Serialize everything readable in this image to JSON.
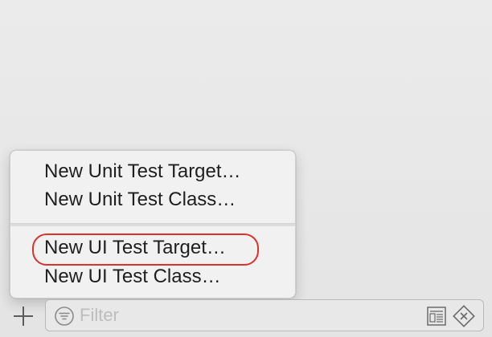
{
  "menu": {
    "items": [
      {
        "label": "New Unit Test Target…"
      },
      {
        "label": "New Unit Test Class…"
      },
      {
        "label": "New UI Test Target…",
        "highlighted": true
      },
      {
        "label": "New UI Test Class…"
      }
    ]
  },
  "bottom_bar": {
    "add_icon": "plus-icon",
    "filter": {
      "placeholder": "Filter",
      "value": "",
      "icon": "filter-icon",
      "toggle_icon": "document-list-icon",
      "clear_icon": "clear-icon"
    }
  },
  "colors": {
    "highlight_ring": "#d9332b",
    "background": "#e8e8e8",
    "menu_background": "#f1f1f1"
  }
}
